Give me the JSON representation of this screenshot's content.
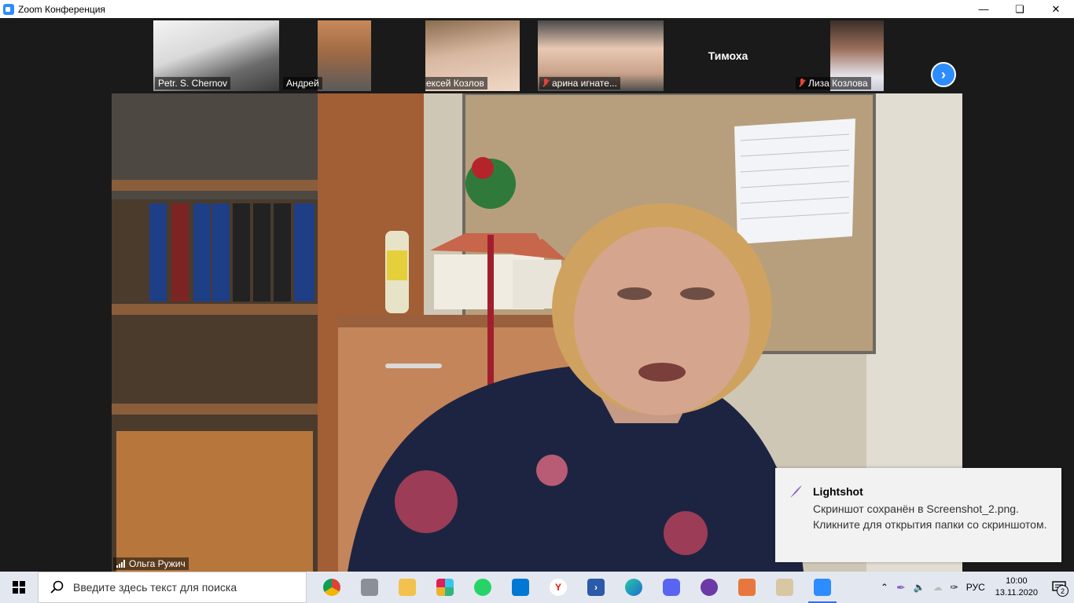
{
  "window": {
    "title": "Zoom Конференция"
  },
  "participants": [
    {
      "name": "Petr. S. Chernov",
      "muted": false
    },
    {
      "name": "Андрей",
      "muted": false
    },
    {
      "name": "Алексей Козлов",
      "muted": false
    },
    {
      "name": "арина игнате...",
      "muted": true
    },
    {
      "name": "Тимоха",
      "muted": false
    },
    {
      "name": "Лиза Козлова",
      "muted": true
    }
  ],
  "main_video": {
    "speaker": "Ольга Ружич"
  },
  "notification": {
    "app": "Lightshot",
    "message": "Скриншот сохранён в Screenshot_2.png. Кликните для открытия папки со скриншотом."
  },
  "taskbar": {
    "search_placeholder": "Введите здесь текст для поиска",
    "apps": [
      "chrome-icon",
      "snip-icon",
      "file-explorer-icon",
      "slack-icon",
      "whatsapp-icon",
      "vscode-icon",
      "yandex-icon",
      "powershell-icon",
      "edge-icon",
      "discord-icon",
      "app-purple-icon",
      "document-icon",
      "paint-icon",
      "zoom-icon"
    ],
    "language": "РУС",
    "time": "10:00",
    "date": "13.11.2020",
    "notifications_count": "2"
  },
  "colors": {
    "accent": "#2d8cff",
    "muted_mic": "#e0453a"
  }
}
